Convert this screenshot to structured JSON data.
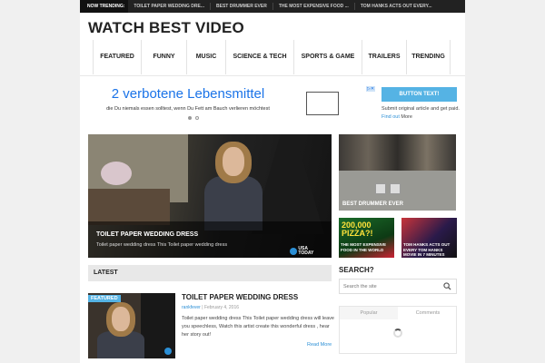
{
  "trending": {
    "label": "NOW TRENDING:",
    "items": [
      "TOILET PAPER WEDDING DRE...",
      "BEST DRUMMER EVER",
      "THE MOST EXPENSIVE FOOD ...",
      "TOM HANKS ACTS OUT EVERY..."
    ]
  },
  "site": {
    "title": "WATCH BEST VIDEO"
  },
  "nav": {
    "items": [
      "FEATURED",
      "FUNNY",
      "MUSIC",
      "SCIENCE & TECH",
      "SPORTS & GAME",
      "TRAILERS",
      "TRENDING"
    ]
  },
  "ad": {
    "headline": "2 verbotene Lebensmittel",
    "subline": "die Du niemals essen solltest, wenn Du Fett am Bauch verlieren möchtest"
  },
  "promo": {
    "button_label": "BUTTON TEXT!",
    "note": "Submit original article and get paid.",
    "find_out": "Find out",
    "more": "More"
  },
  "hero": {
    "title": "TOILET PAPER WEDDING DRESS",
    "subtitle": "Toilet paper wedding dress This Toilet paper wedding dress",
    "logo_top": "USA",
    "logo_bottom": "TODAY"
  },
  "side": {
    "big_title": "BEST DRUMMER EVER",
    "small": [
      {
        "title": "THE MOST EXPENSIVE FOOD IN THE WORLD"
      },
      {
        "title": "TOM HANKS ACTS OUT EVERY TOM HANKS MOVIE IN 7 MINUTES"
      }
    ]
  },
  "latest": {
    "heading": "LATEST",
    "post": {
      "tag": "FEATURED",
      "title": "TOILET PAPER WEDDING DRESS",
      "author": "rankfever",
      "date": "February 4, 2016",
      "excerpt": "Toilet paper wedding dress This Toilet paper wedding dress will leave you speechless, Watch this artist create this wonderful dress , hear her story out!",
      "read_more": "Read More"
    }
  },
  "sidebar": {
    "search_heading": "SEARCH?",
    "search_placeholder": "Search the site",
    "tabs": [
      "Popular",
      "Comments"
    ]
  },
  "colors": {
    "accent": "#55b3e4",
    "link": "#2b8fd6",
    "topbar": "#222222",
    "ad_blue": "#1a73e8"
  }
}
